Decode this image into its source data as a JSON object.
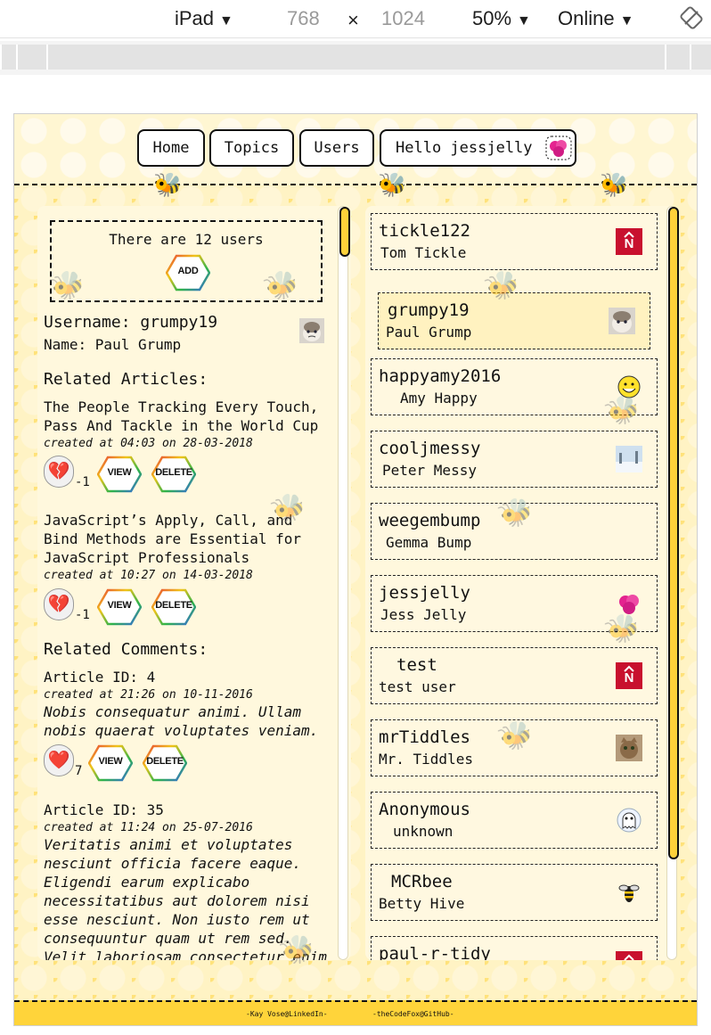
{
  "devtools": {
    "device": "iPad",
    "width": "768",
    "times": "×",
    "height": "1024",
    "zoom": "50%",
    "network": "Online"
  },
  "nav": {
    "home": "Home",
    "topics": "Topics",
    "users": "Users",
    "hello": "Hello jessjelly"
  },
  "left": {
    "user_count_text": "There are 12 users",
    "add_label": "ADD",
    "username": "Username: grumpy19",
    "name": "Name: Paul Grump",
    "related_articles_heading": "Related Articles:",
    "articles": [
      {
        "title_lines": [
          "The People Tracking Every Touch,",
          "Pass And Tackle in the World Cup"
        ],
        "created": "created at 04:03 on 28-03-2018",
        "votes": "-1",
        "view_label": "VIEW",
        "delete_label": "DELETE"
      },
      {
        "title_lines": [
          "JavaScript’s Apply, Call, and",
          "Bind Methods are Essential for",
          "JavaScript Professionals"
        ],
        "created": "created at 10:27 on 14-03-2018",
        "votes": "-1",
        "view_label": "VIEW",
        "delete_label": "DELETE"
      }
    ],
    "related_comments_heading": "Related Comments:",
    "comments": [
      {
        "article_id": "Article ID: 4",
        "created": "created at 21:26 on 10-11-2016",
        "body_lines": [
          "Nobis consequatur animi. Ullam",
          "nobis quaerat voluptates veniam."
        ],
        "votes": "7",
        "view_label": "VIEW",
        "delete_label": "DELETE"
      },
      {
        "article_id": "Article ID: 35",
        "created": "created at 11:24 on 25-07-2016",
        "body_lines": [
          "Veritatis animi et voluptates",
          "nesciunt officia facere eaque.",
          "Eligendi earum explicabo",
          "necessitatibus aut dolorem nisi",
          "esse nesciunt. Non iusto rem ut",
          "consequuntur quam ut rem sed.",
          "Velit laboriosam consectetur enim"
        ]
      }
    ]
  },
  "users": [
    {
      "username": "tickle122",
      "name": "Tom Tickle",
      "avatar": "red-n-logo"
    },
    {
      "username": "grumpy19",
      "name": "Paul Grump",
      "avatar": "grumpy-cat",
      "selected": true
    },
    {
      "username": "happyamy2016",
      "name": "Amy Happy",
      "avatar": "mr-happy"
    },
    {
      "username": "cooljmessy",
      "name": "Peter Messy",
      "avatar": "snowy-landscape"
    },
    {
      "username": "weegembump",
      "name": "Gemma Bump",
      "avatar": ""
    },
    {
      "username": "jessjelly",
      "name": "Jess Jelly",
      "avatar": "pink-jelly"
    },
    {
      "username": "test",
      "name": "test user",
      "avatar": "red-n-logo"
    },
    {
      "username": "mrTiddles",
      "name": "Mr. Tiddles",
      "avatar": "tabby-cat"
    },
    {
      "username": "Anonymous",
      "name": "unknown",
      "avatar": "ghost"
    },
    {
      "username": "MCRbee",
      "name": "Betty Hive",
      "avatar": "bee"
    },
    {
      "username": "paul-r-tidy",
      "name": "",
      "avatar": "red-n-logo"
    }
  ],
  "footer": {
    "linkedin": "-Kay Vose@LinkedIn-",
    "github": "-theCodeFox@GitHub-"
  },
  "colors": {
    "honey": "#ffd43a",
    "hex_light": "#fff6d6",
    "accent_red": "#c8102e"
  }
}
